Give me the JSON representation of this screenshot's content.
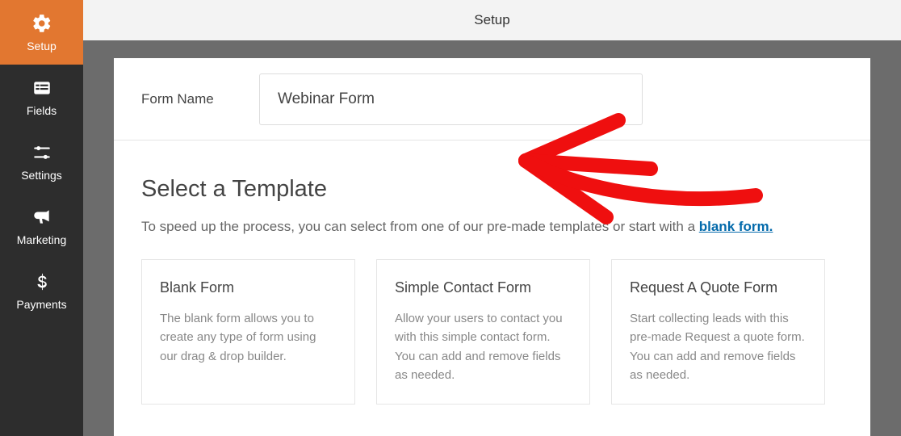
{
  "topbar": {
    "title": "Setup"
  },
  "sidebar": {
    "items": [
      {
        "label": "Setup"
      },
      {
        "label": "Fields"
      },
      {
        "label": "Settings"
      },
      {
        "label": "Marketing"
      },
      {
        "label": "Payments"
      }
    ]
  },
  "form_name": {
    "label": "Form Name",
    "value": "Webinar Form"
  },
  "templates": {
    "heading": "Select a Template",
    "desc_prefix": "To speed up the process, you can select from one of our pre-made templates or start with a ",
    "blank_link": "blank form.",
    "cards": [
      {
        "title": "Blank Form",
        "desc": "The blank form allows you to create any type of form using our drag & drop builder."
      },
      {
        "title": "Simple Contact Form",
        "desc": "Allow your users to contact you with this simple contact form. You can add and remove fields as needed."
      },
      {
        "title": "Request A Quote Form",
        "desc": "Start collecting leads with this pre-made Request a quote form. You can add and remove fields as needed."
      }
    ]
  }
}
